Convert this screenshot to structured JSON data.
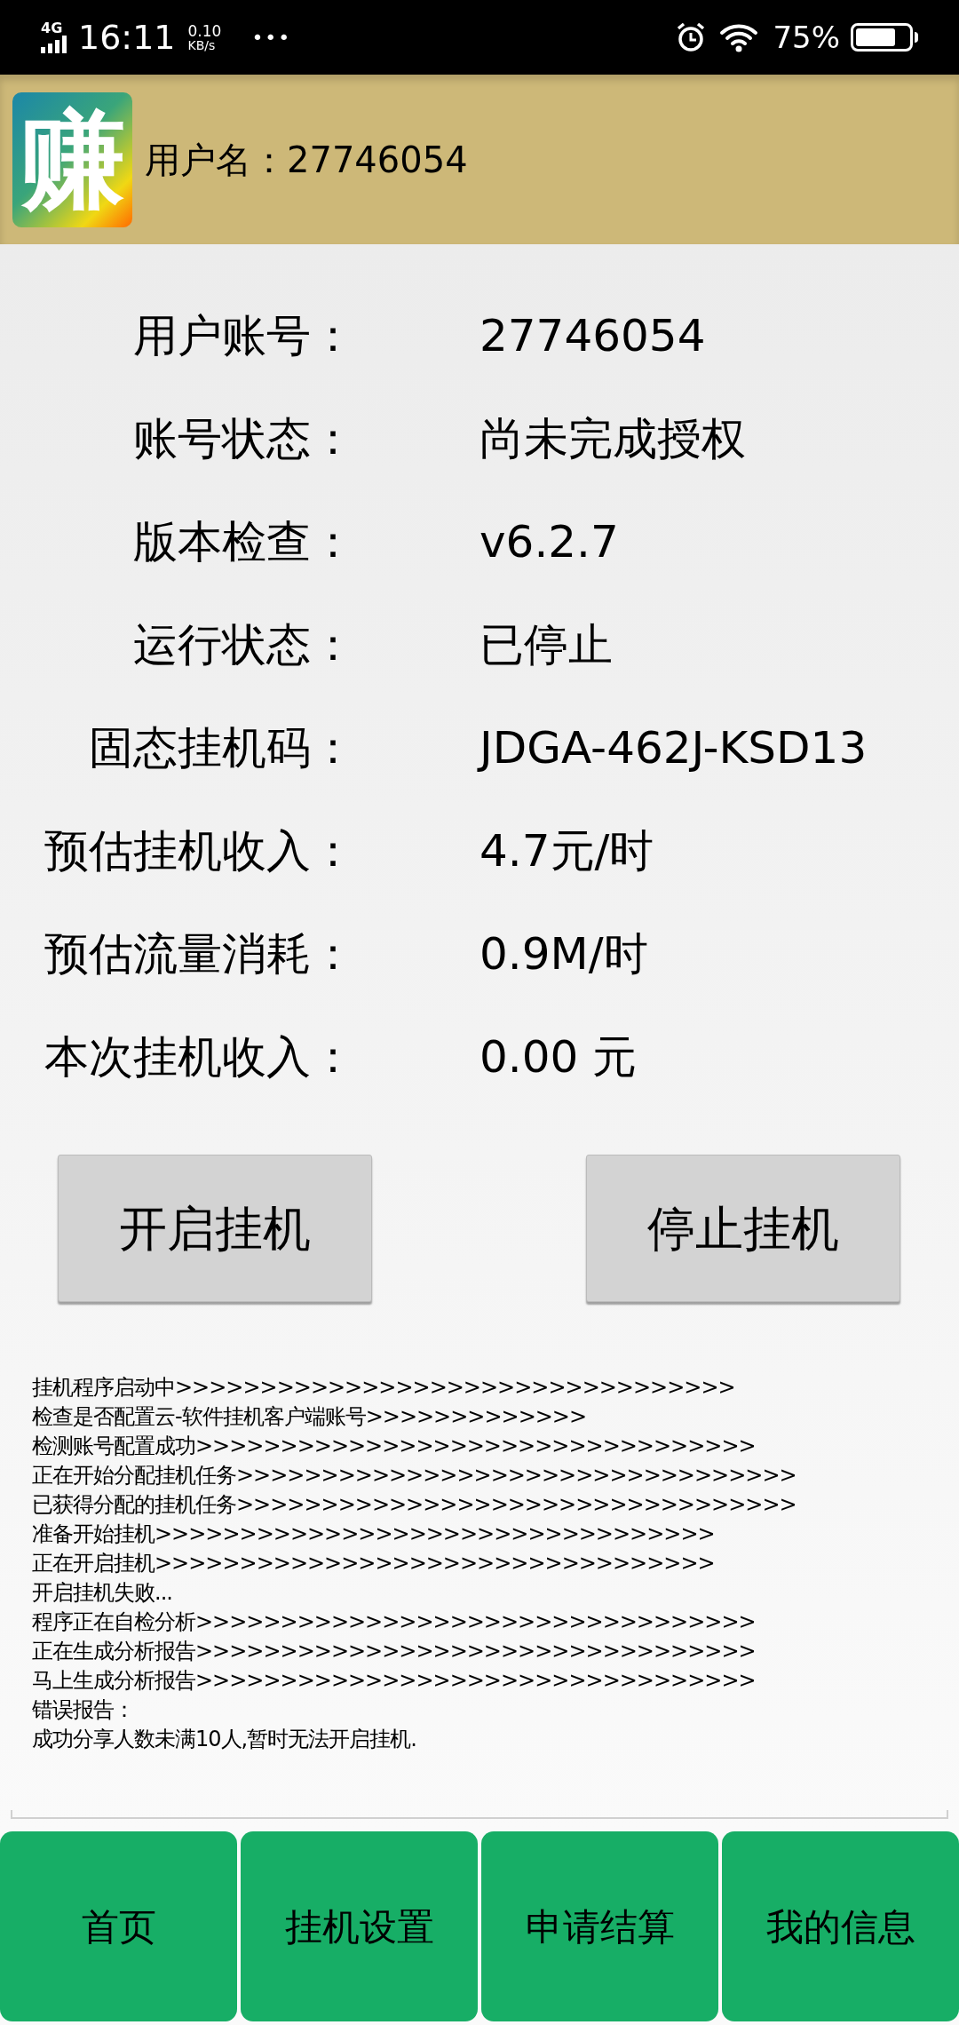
{
  "status_bar": {
    "network": "4G",
    "time": "16:11",
    "speed": "0.10",
    "speed_unit": "KB/s",
    "more": "•••",
    "battery": "75%"
  },
  "header": {
    "logo_char": "赚",
    "username": "用户名：27746054"
  },
  "info_rows": [
    {
      "label": "用户账号：",
      "value": "27746054"
    },
    {
      "label": "账号状态：",
      "value": "尚未完成授权"
    },
    {
      "label": "版本检查：",
      "value": "v6.2.7"
    },
    {
      "label": "运行状态：",
      "value": "已停止"
    },
    {
      "label": "固态挂机码：",
      "value": "JDGA-462J-KSD13"
    },
    {
      "label": "预估挂机收入：",
      "value": "4.7元/时"
    },
    {
      "label": "预估流量消耗：",
      "value": "0.9M/时"
    },
    {
      "label": "本次挂机收入：",
      "value": "0.00 元"
    }
  ],
  "buttons": [
    "开启挂机",
    "停止挂机"
  ],
  "log_lines": [
    "挂机程序启动中>>>>>>>>>>>>>>>>>>>>>>>>>>>>>>>>>",
    "检查是否配置云-软件挂机客户端账号>>>>>>>>>>>>>",
    "检测账号配置成功>>>>>>>>>>>>>>>>>>>>>>>>>>>>>>>>>",
    "正在开始分配挂机任务>>>>>>>>>>>>>>>>>>>>>>>>>>>>>>>>>",
    "已获得分配的挂机任务>>>>>>>>>>>>>>>>>>>>>>>>>>>>>>>>>",
    "准备开始挂机>>>>>>>>>>>>>>>>>>>>>>>>>>>>>>>>>",
    "正在开启挂机>>>>>>>>>>>>>>>>>>>>>>>>>>>>>>>>>",
    "开启挂机失败...",
    "程序正在自检分析>>>>>>>>>>>>>>>>>>>>>>>>>>>>>>>>>",
    "正在生成分析报告>>>>>>>>>>>>>>>>>>>>>>>>>>>>>>>>>",
    "马上生成分析报告>>>>>>>>>>>>>>>>>>>>>>>>>>>>>>>>>",
    "错误报告：",
    "成功分享人数未满10人,暂时无法开启挂机."
  ],
  "bottom_nav": [
    "首页",
    "挂机设置",
    "申请结算",
    "我的信息"
  ]
}
